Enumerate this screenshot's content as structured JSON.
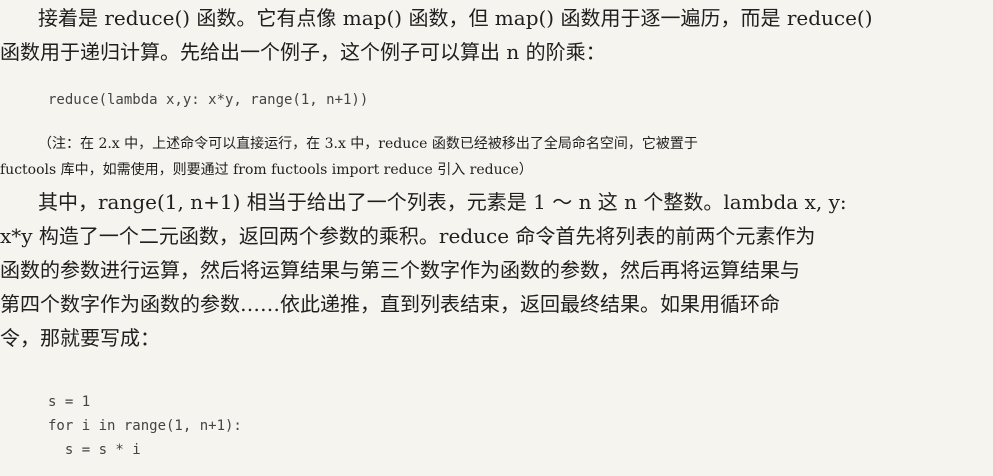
{
  "paragraph1": {
    "line1": "接着是 reduce() 函数。它有点像 map() 函数，但 map() 函数用于逐一遍历，而是 reduce()",
    "line2": "函数用于递归计算。先给出一个例子，这个例子可以算出 n 的阶乘："
  },
  "code1": "reduce(lambda x,y: x*y, range(1, n+1))",
  "note": {
    "line1": "（注：在 2.x 中，上述命令可以直接运行，在 3.x 中，reduce 函数已经被移出了全局命名空间，它被置于",
    "line2": "fuctools 库中，如需使用，则要通过 from fuctools import reduce 引入 reduce）"
  },
  "paragraph2": {
    "line1": "其中，range(1, n+1) 相当于给出了一个列表，元素是 1 ～ n 这 n 个整数。lambda x, y:",
    "line2": "x*y 构造了一个二元函数，返回两个参数的乘积。reduce 命令首先将列表的前两个元素作为",
    "line3": "函数的参数进行运算，然后将运算结果与第三个数字作为函数的参数，然后再将运算结果与",
    "line4": "第四个数字作为函数的参数……依此递推，直到列表结束，返回最终结果。如果用循环命",
    "line5": "令，那就要写成："
  },
  "code2": {
    "line1": "s = 1",
    "line2": "for i in range(1, n+1):",
    "line3": "  s = s * i"
  }
}
